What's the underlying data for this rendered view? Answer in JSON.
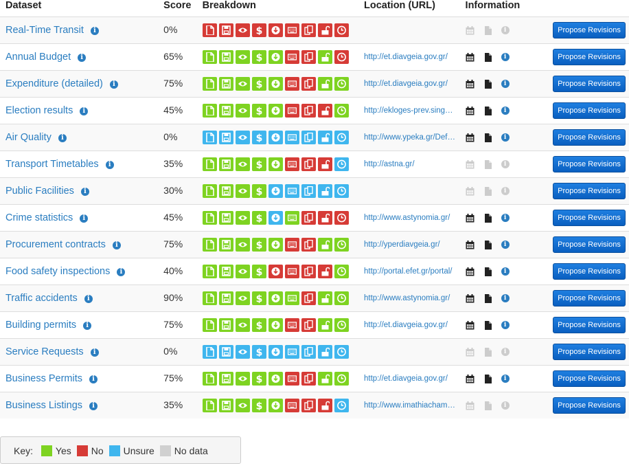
{
  "colors": {
    "yes": "#7ed321",
    "no": "#d63b36",
    "unsure": "#3fb6ee",
    "nodata": "#d0d0d0",
    "link": "#2a7dc0",
    "info_active": "#2a7dc0",
    "info_inactive": "#cccccc"
  },
  "headers": {
    "dataset": "Dataset",
    "score": "Score",
    "breakdown": "Breakdown",
    "location": "Location (URL)",
    "information": "Information"
  },
  "breakdown_icons": [
    "file-icon",
    "floppy-disk-icon",
    "eye-icon",
    "dollar-icon",
    "download-icon",
    "keyboard-icon",
    "copy-icon",
    "unlock-icon",
    "clock-icon"
  ],
  "button_label": "Propose Revisions",
  "rows": [
    {
      "name": "Real-Time Transit",
      "score": "0%",
      "breakdown": [
        "n",
        "n",
        "n",
        "n",
        "n",
        "n",
        "n",
        "n",
        "n"
      ],
      "url": "",
      "info": false
    },
    {
      "name": "Annual Budget",
      "score": "65%",
      "breakdown": [
        "y",
        "y",
        "y",
        "y",
        "y",
        "n",
        "n",
        "y",
        "n"
      ],
      "url": "http://et.diavgeia.gov.gr/",
      "info": true
    },
    {
      "name": "Expenditure (detailed)",
      "score": "75%",
      "breakdown": [
        "y",
        "y",
        "y",
        "y",
        "y",
        "n",
        "n",
        "y",
        "y"
      ],
      "url": "http://et.diavgeia.gov.gr/",
      "info": true
    },
    {
      "name": "Election results",
      "score": "45%",
      "breakdown": [
        "y",
        "y",
        "y",
        "y",
        "y",
        "n",
        "n",
        "n",
        "y"
      ],
      "url": "http://ekloges-prev.singularlogic.eu/",
      "info": true
    },
    {
      "name": "Air Quality",
      "score": "0%",
      "breakdown": [
        "u",
        "u",
        "u",
        "u",
        "u",
        "u",
        "u",
        "u",
        "u"
      ],
      "url": "http://www.ypeka.gr/Default.aspx",
      "info": true
    },
    {
      "name": "Transport Timetables",
      "score": "35%",
      "breakdown": [
        "y",
        "y",
        "y",
        "y",
        "y",
        "n",
        "n",
        "n",
        "u"
      ],
      "url": "http://astna.gr/",
      "info": false
    },
    {
      "name": "Public Facilities",
      "score": "30%",
      "breakdown": [
        "y",
        "y",
        "y",
        "y",
        "u",
        "u",
        "u",
        "u",
        "u"
      ],
      "url": "",
      "info": false
    },
    {
      "name": "Crime statistics",
      "score": "45%",
      "breakdown": [
        "y",
        "y",
        "y",
        "y",
        "u",
        "y",
        "n",
        "n",
        "n"
      ],
      "url": "http://www.astynomia.gr/",
      "info": true
    },
    {
      "name": "Procurement contracts",
      "score": "75%",
      "breakdown": [
        "y",
        "y",
        "y",
        "y",
        "y",
        "n",
        "n",
        "y",
        "y"
      ],
      "url": "http://yperdiavgeia.gr/",
      "info": true
    },
    {
      "name": "Food safety inspections",
      "score": "40%",
      "breakdown": [
        "y",
        "y",
        "y",
        "y",
        "n",
        "n",
        "n",
        "n",
        "y"
      ],
      "url": "http://portal.efet.gr/portal/",
      "info": true
    },
    {
      "name": "Traffic accidents",
      "score": "90%",
      "breakdown": [
        "y",
        "y",
        "y",
        "y",
        "y",
        "y",
        "n",
        "y",
        "y"
      ],
      "url": "http://www.astynomia.gr/",
      "info": true
    },
    {
      "name": "Building permits",
      "score": "75%",
      "breakdown": [
        "y",
        "y",
        "y",
        "y",
        "y",
        "n",
        "n",
        "y",
        "y"
      ],
      "url": "http://et.diavgeia.gov.gr/",
      "info": true
    },
    {
      "name": "Service Requests",
      "score": "0%",
      "breakdown": [
        "u",
        "u",
        "u",
        "u",
        "u",
        "u",
        "u",
        "u",
        "u"
      ],
      "url": "",
      "info": false
    },
    {
      "name": "Business Permits",
      "score": "75%",
      "breakdown": [
        "y",
        "y",
        "y",
        "y",
        "y",
        "n",
        "n",
        "y",
        "y"
      ],
      "url": "http://et.diavgeia.gov.gr/",
      "info": true
    },
    {
      "name": "Business Listings",
      "score": "35%",
      "breakdown": [
        "y",
        "y",
        "y",
        "y",
        "y",
        "n",
        "n",
        "n",
        "u"
      ],
      "url": "http://www.imathiachamber.gr/",
      "info": false
    }
  ],
  "key": {
    "label": "Key:",
    "items": [
      {
        "label": "Yes",
        "status": "y"
      },
      {
        "label": "No",
        "status": "n"
      },
      {
        "label": "Unsure",
        "status": "u"
      },
      {
        "label": "No data",
        "status": "x"
      }
    ]
  }
}
